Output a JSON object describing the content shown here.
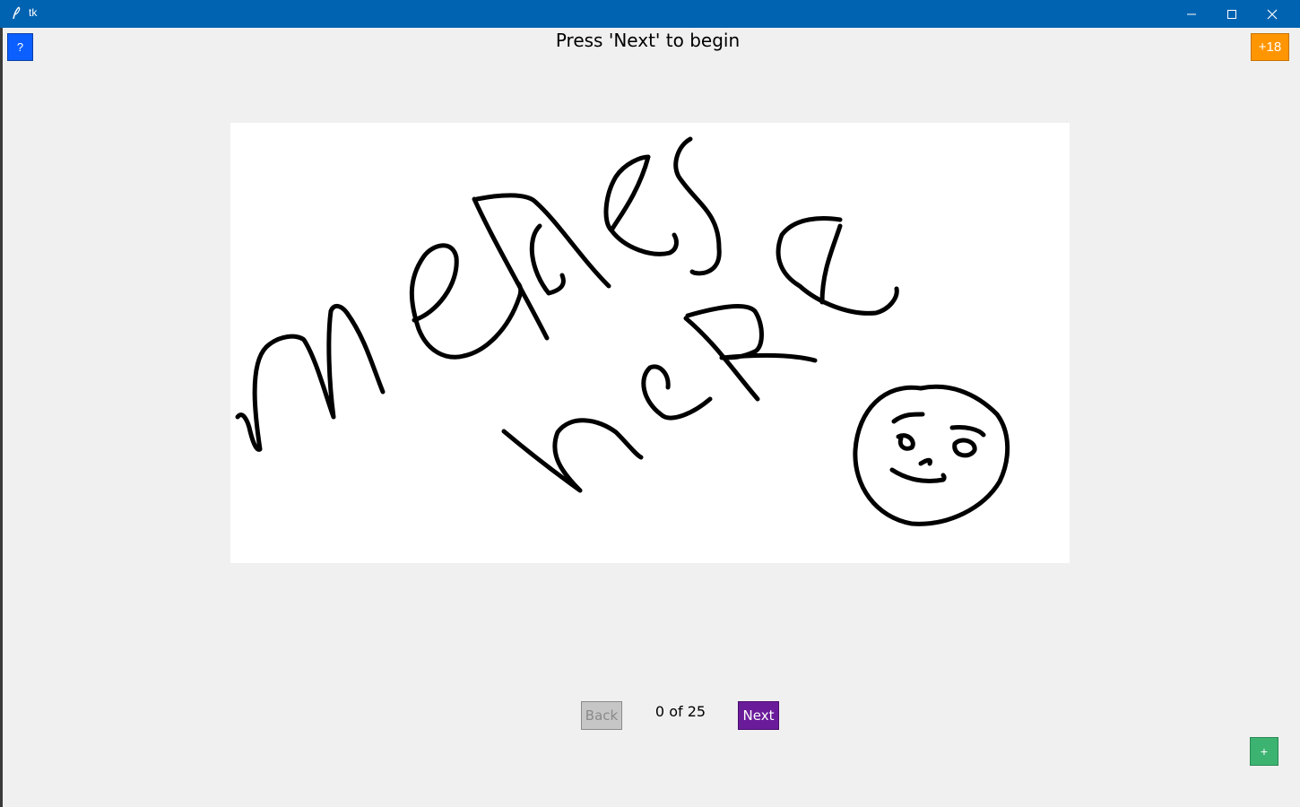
{
  "window": {
    "title": "tk",
    "titlebar_color": "#0063b1"
  },
  "toolbar": {
    "help_label": "?",
    "help_color": "#0b5fff",
    "age_label": "+18",
    "age_color": "#ff9500"
  },
  "main": {
    "heading": "Press 'Next' to begin",
    "image": {
      "description_icon": "handwritten-drawing",
      "handwritten_text": "memes here"
    }
  },
  "navigation": {
    "back_label": "Back",
    "back_enabled": false,
    "counter_text": "0 of 25",
    "current": 0,
    "total": 25,
    "next_label": "Next",
    "next_color": "#6a1b9a"
  },
  "fab": {
    "add_label": "+",
    "add_color": "#3cb371"
  }
}
